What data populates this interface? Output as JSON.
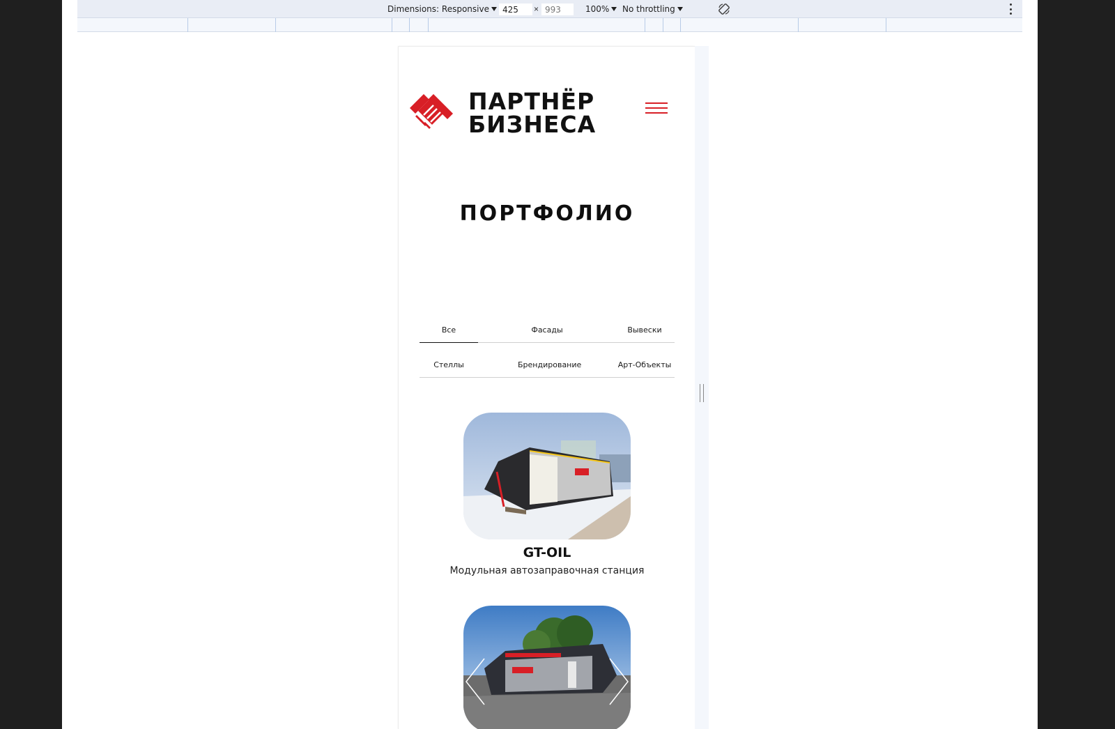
{
  "devtools": {
    "dimensions_label": "Dimensions: Responsive",
    "width_value": "425",
    "height_value": "993",
    "times": "×",
    "zoom": "100%",
    "throttling": "No throttling"
  },
  "site": {
    "logo_line1": "ПАРТНЁР",
    "logo_line2": "БИЗНЕСА",
    "brand_color": "#d81f26",
    "page_title": "ПОРТФОЛИО",
    "filters": [
      {
        "label": "Все",
        "active": true
      },
      {
        "label": "Фасады",
        "active": false
      },
      {
        "label": "Вывески",
        "active": false
      },
      {
        "label": "Стеллы",
        "active": false
      },
      {
        "label": "Брендирование",
        "active": false
      },
      {
        "label": "Арт-Объекты",
        "active": false
      }
    ],
    "portfolio": [
      {
        "title": "GT-OIL",
        "description": "Модульная автозаправочная станция"
      },
      {
        "title": "",
        "description": ""
      }
    ]
  }
}
